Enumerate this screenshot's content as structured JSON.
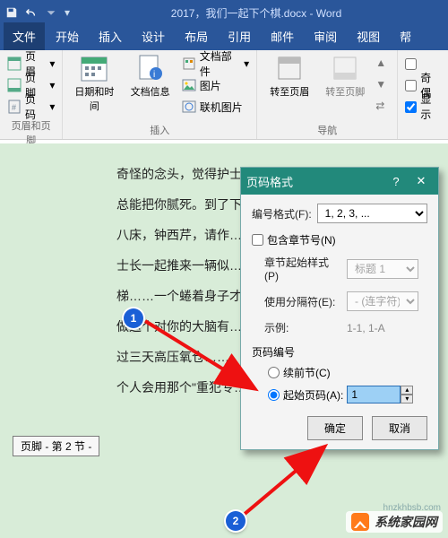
{
  "title": "2017，我们一起下个棋.docx - Word",
  "qat": {
    "save": "save-icon",
    "undo": "undo-icon",
    "redo": "redo-icon"
  },
  "tabs": [
    "文件",
    "开始",
    "插入",
    "设计",
    "布局",
    "引用",
    "邮件",
    "审阅",
    "视图",
    "帮"
  ],
  "ribbon": {
    "group_hf": {
      "label": "页眉和页脚",
      "items": [
        "页眉",
        "页脚",
        "页码"
      ]
    },
    "group_insert": {
      "label": "插入",
      "datetime": "日期和时间",
      "docinfo": "文档信息",
      "docparts": "文档部件",
      "picture": "图片",
      "online_pic": "联机图片"
    },
    "group_nav": {
      "label": "导航",
      "goto_header": "转至页眉",
      "goto_footer": "转至页脚"
    },
    "group_opts": {
      "odd_even": "奇偶",
      "show": "显示"
    }
  },
  "doc_lines": [
    "奇怪的念头，觉得护士……",
    "总能把你腻死。到了下……",
    "八床，钟西芹，请作……",
    "士长一起推来一辆似……",
    "梯……一个蜷着身子才……",
    "做这个对你的大脑有……",
    "过三天高压氧仓……",
    "个人会用那个\"重犯专……"
  ],
  "footer_tab": "页脚 - 第 2 节 -",
  "dialog": {
    "title": "页码格式",
    "format_label": "编号格式(F):",
    "format_value": "1, 2, 3, ...",
    "include_chapter": "包含章节号(N)",
    "chapter_style_lbl": "章节起始样式(P)",
    "chapter_style_val": "标题 1",
    "separator_lbl": "使用分隔符(E):",
    "separator_val": "- (连字符)",
    "example_lbl": "示例:",
    "example_val": "1-1, 1-A",
    "pagenum_hdr": "页码编号",
    "continue_lbl": "续前节(C)",
    "start_at_lbl": "起始页码(A):",
    "start_at_val": "1",
    "ok": "确定",
    "cancel": "取消"
  },
  "callouts": {
    "c1": "1",
    "c2": "2"
  },
  "watermark": {
    "text": "系统家园网",
    "sub": "hnzkhbsb.com"
  }
}
